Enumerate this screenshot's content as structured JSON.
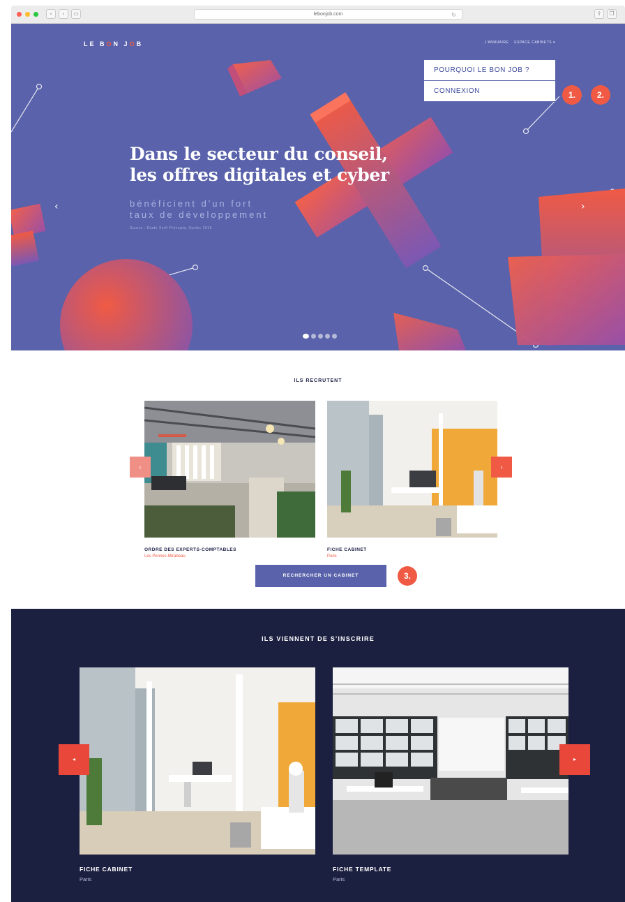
{
  "browser": {
    "url": "lebonjob.com",
    "traffic_colors": [
      "#ff5f57",
      "#febc2e",
      "#28c840"
    ]
  },
  "header": {
    "logo_parts": [
      "LE B",
      "O",
      "N J",
      "O",
      "B"
    ],
    "nav": [
      "L'ANNUAIRE",
      "ESPACE CABINETS ▾"
    ]
  },
  "dropdown": {
    "items": [
      "POURQUOI LE BON JOB ?",
      "CONNEXION"
    ]
  },
  "badges": [
    "1.",
    "2.",
    "3."
  ],
  "hero": {
    "title_line1": "Dans le secteur du conseil,",
    "title_line2": "les offres digitales et cyber",
    "subtitle_line1": "bénéficient d'un fort",
    "subtitle_line2": "taux de développement",
    "source": "Source : Étude Xerfi Précepta, Syntec 2018",
    "arrow_left": "‹",
    "arrow_right": "›",
    "slide_count": 5,
    "active_slide": 1
  },
  "recruit": {
    "title": "ILS RECRUTENT",
    "cards": [
      {
        "name": "ORDRE DES EXPERTS-COMPTABLES",
        "location": "Les Pennes-Mirabeau"
      },
      {
        "name": "FICHE CABINET",
        "location": "Paris"
      }
    ],
    "prev_label": "‹",
    "next_label": "›",
    "search_button": "RECHERCHER UN CABINET"
  },
  "newcomers": {
    "title": "ILS VIENNENT DE S'INSCRIRE",
    "cards": [
      {
        "name": "FICHE CABINET",
        "location": "Paris"
      },
      {
        "name": "FICHE TEMPLATE",
        "location": "Paris"
      }
    ],
    "prev_label": "◂",
    "next_label": "▸"
  },
  "colors": {
    "hero_bg": "#5962aa",
    "accent": "#f05a44",
    "dark_bg": "#1c2040",
    "button": "#5962aa"
  }
}
